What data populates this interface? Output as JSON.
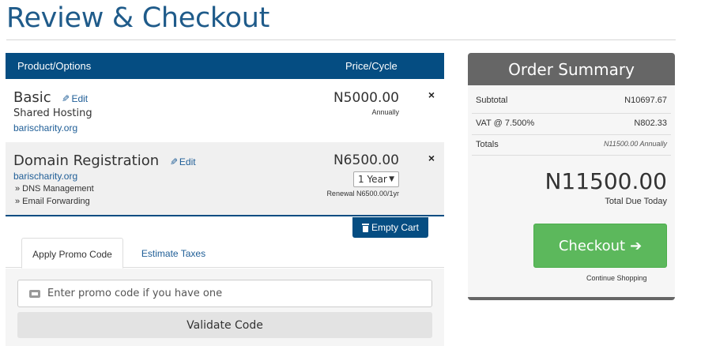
{
  "page_title": "Review & Checkout",
  "cart": {
    "header": {
      "product": "Product/Options",
      "price": "Price/Cycle"
    },
    "items": [
      {
        "name": "Basic",
        "edit": "Edit",
        "type": "Shared Hosting",
        "domain": "barischarity.org",
        "price": "N5000.00",
        "cycle": "Annually"
      },
      {
        "name": "Domain Registration",
        "edit": "Edit",
        "domain": "barischarity.org",
        "addons": [
          "» DNS Management",
          "» Email Forwarding"
        ],
        "price": "N6500.00",
        "period": "1 Year",
        "renewal": "Renewal N6500.00/1yr"
      }
    ],
    "remove_symbol": "×",
    "empty_cart": "Empty Cart"
  },
  "tabs": [
    "Apply Promo Code",
    "Estimate Taxes"
  ],
  "promo": {
    "placeholder": "Enter promo code if you have one",
    "validate": "Validate Code"
  },
  "summary": {
    "title": "Order Summary",
    "subtotal_label": "Subtotal",
    "subtotal_value": "N10697.67",
    "vat_label": "VAT @ 7.500%",
    "vat_value": "N802.33",
    "totals_label": "Totals",
    "totals_value": "N11500.00 Annually",
    "total_due": "N11500.00",
    "total_due_label": "Total Due Today",
    "checkout": "Checkout",
    "continue": "Continue Shopping"
  },
  "colors": {
    "primary": "#054d82",
    "title": "#1f5b8a",
    "link": "#1e5d96",
    "checkout": "#5cb85c",
    "summary_head": "#666666"
  },
  "icons": [
    "pencil-icon",
    "close-icon",
    "trash-icon",
    "ticket-icon",
    "arrow-right-icon",
    "caret-down-icon"
  ]
}
